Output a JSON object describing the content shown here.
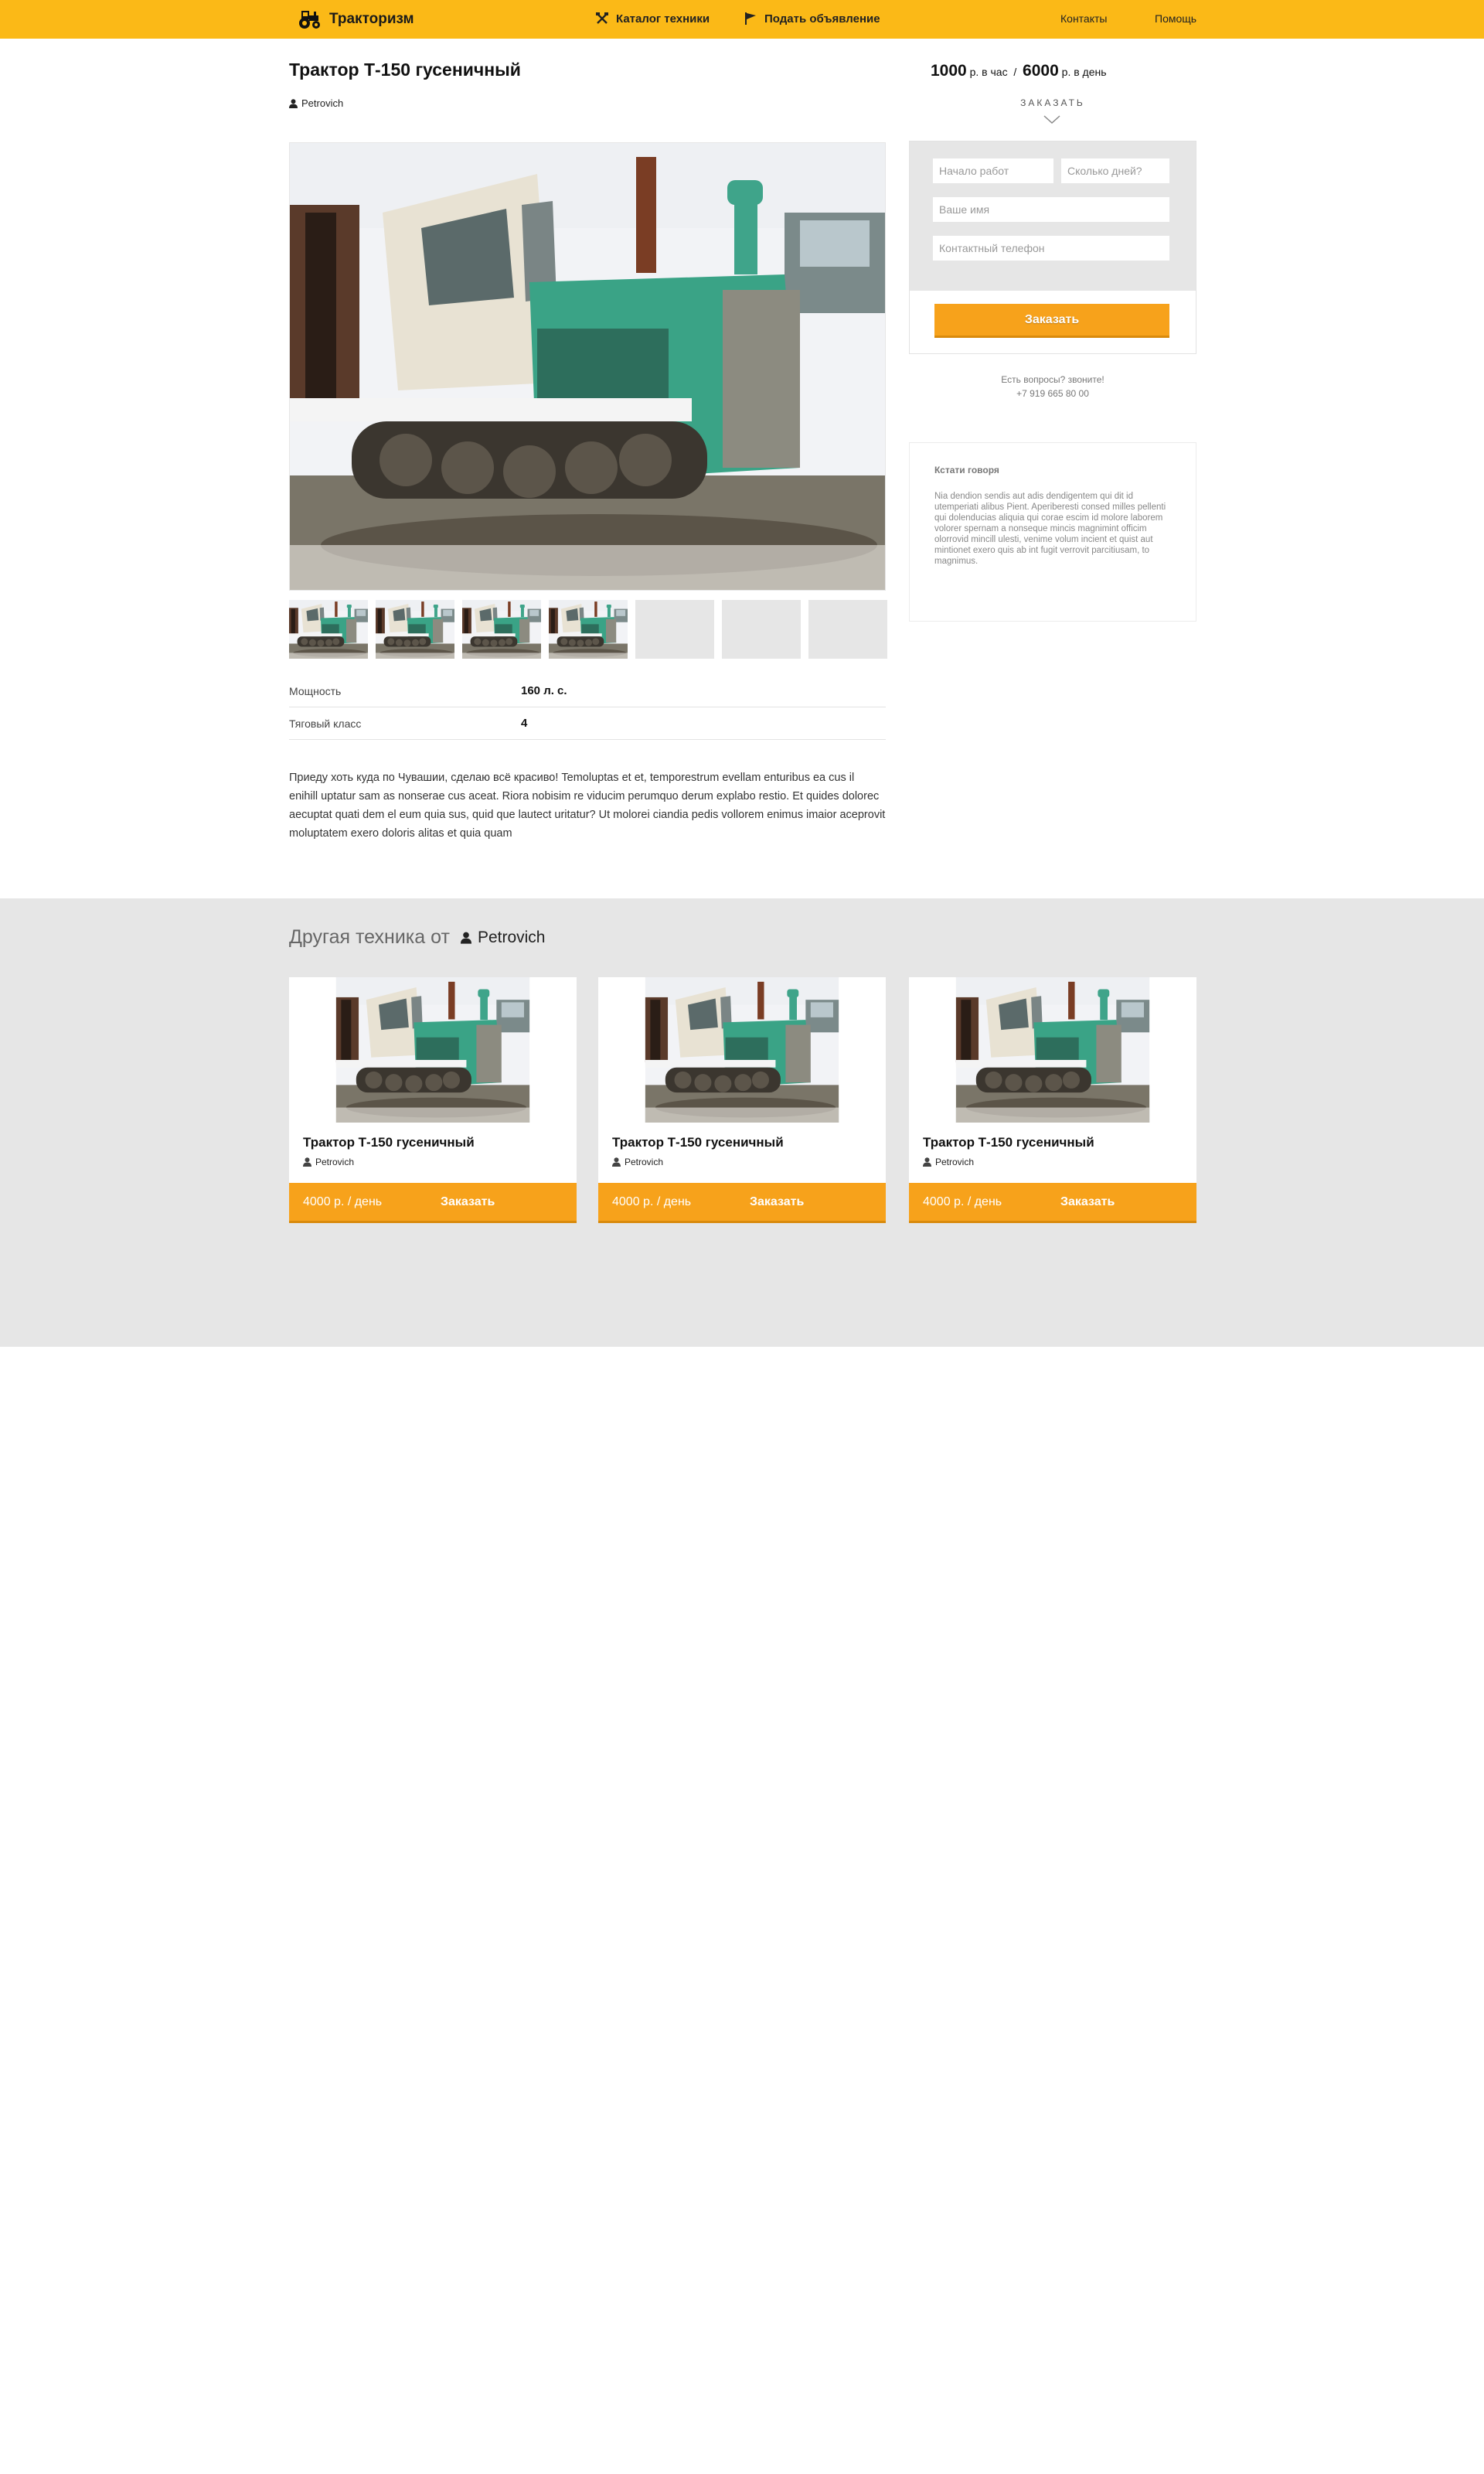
{
  "header": {
    "logo_text": "Тракторизм",
    "nav": {
      "catalog": "Каталог техники",
      "post_ad": "Подать объявление",
      "contacts": "Контакты",
      "help": "Помощь"
    },
    "icons": [
      "tractor-icon",
      "tools-icon",
      "flag-icon"
    ]
  },
  "listing": {
    "title": "Трактор Т-150 гусеничный",
    "author": "Petrovich",
    "thumbnails_filled": 4,
    "thumbnails_empty": 3,
    "specs": [
      {
        "label": "Мощность",
        "value": "160 л. с."
      },
      {
        "label": "Тяговый класс",
        "value": "4"
      }
    ],
    "description": "Приеду хоть куда по Чувашии, сделаю всё красиво! Temoluptas et et, temporestrum evellam enturibus ea cus il enihill uptatur sam as nonserae cus aceat. Riora nobisim re viducim perumquo derum explabo restio. Et quides dolorec aecuptat quati dem el eum quia sus, quid que lautect uritatur? Ut molorei ciandia pedis vollorem enimus imaior aceprovit moluptatem exero doloris alitas et quia quam"
  },
  "order": {
    "price_hour": "1000",
    "price_hour_unit": "р. в час",
    "separator": "/",
    "price_day": "6000",
    "price_day_unit": "р. в день",
    "label": "ЗАКАЗАТЬ",
    "fields": {
      "start": "Начало работ",
      "days": "Сколько дней?",
      "name": "Ваше имя",
      "phone": "Контактный телефон"
    },
    "button": "Заказать",
    "questions": "Есть вопросы? звоните!",
    "phone": "+7 919 665 80 00"
  },
  "info": {
    "title": "Кстати говоря",
    "text": "Nia dendion sendis aut adis dendigentem qui dit id utemperiati alibus Pient. Aperiberesti consed milles pellenti qui dolenducias aliquia qui corae escim id molore laborem volorer spernam a nonseque mincis magnimint officim olorrovid mincill ulesti, venime volum incient et quist aut mintionet exero quis ab int fugit verrovit parcitiusam, to magnimus."
  },
  "other": {
    "title": "Другая техника от",
    "owner": "Petrovich",
    "cards": [
      {
        "name": "Трактор Т-150 гусеничный",
        "author": "Petrovich",
        "price": "4000 р. / день",
        "button": "Заказать"
      },
      {
        "name": "Трактор Т-150 гусеничный",
        "author": "Petrovich",
        "price": "4000 р. / день",
        "button": "Заказать"
      },
      {
        "name": "Трактор Т-150 гусеничный",
        "author": "Petrovich",
        "price": "4000 р. / день",
        "button": "Заказать"
      }
    ]
  },
  "colors": {
    "header": "#fbb917",
    "accent": "#f7a21b",
    "section_bg": "#e6e6e6"
  }
}
